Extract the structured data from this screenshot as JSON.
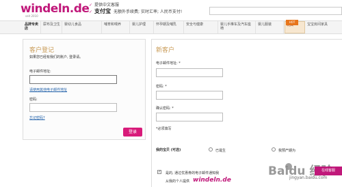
{
  "header": {
    "logo": "windeln.de",
    "logo_tagline": "seit 2010",
    "promo_line1": "提供中文客服",
    "promo_alipay": "支付宝",
    "promo_line2": "无额外手续费; 实时汇率; 人民币支付!"
  },
  "nav": {
    "items": [
      {
        "label": "品牌专卖店"
      },
      {
        "label": "尿布及卫生"
      },
      {
        "label": "婴幼儿食品"
      },
      {
        "label": "哺育和喂养"
      },
      {
        "label": "婴儿护理"
      },
      {
        "label": "怀孕期及哺乳"
      },
      {
        "label": "安全与健康"
      },
      {
        "label": "婴儿手推车及汽车座椅"
      },
      {
        "label": "婴儿服装"
      },
      {
        "label": "玩具"
      },
      {
        "label": "宝宝房间家具"
      }
    ],
    "hot_badge": "HOT"
  },
  "login": {
    "title": "客户登记",
    "subtitle": "如果您已经有我们的账户, 登录请。",
    "email_label": "电子邮件地址:",
    "other_email_link": "请使用其他电子邮件地址",
    "password_label": "密码:",
    "forgot_link": "忘记密码?",
    "login_button": "登录"
  },
  "register": {
    "title": "新客户",
    "email_label": "电子邮件地址: *",
    "password_label": "密码: *",
    "confirm_label": "确认密码: *",
    "required_note": "*必须填写",
    "baby_label": "我的宝贝 (可选)",
    "option_born": "已诞生",
    "option_expecting": "我预产期为",
    "newsletter_label": "是的, 通过优惠券的电子邮件通知我",
    "newsletter_sub": "从我的个人提供",
    "newsletter_brand": "windeln.de"
  },
  "watermark": {
    "text": "Baidu 经验",
    "url": "jingyan.baidu.com"
  },
  "sidebar_tab": "在线客服"
}
